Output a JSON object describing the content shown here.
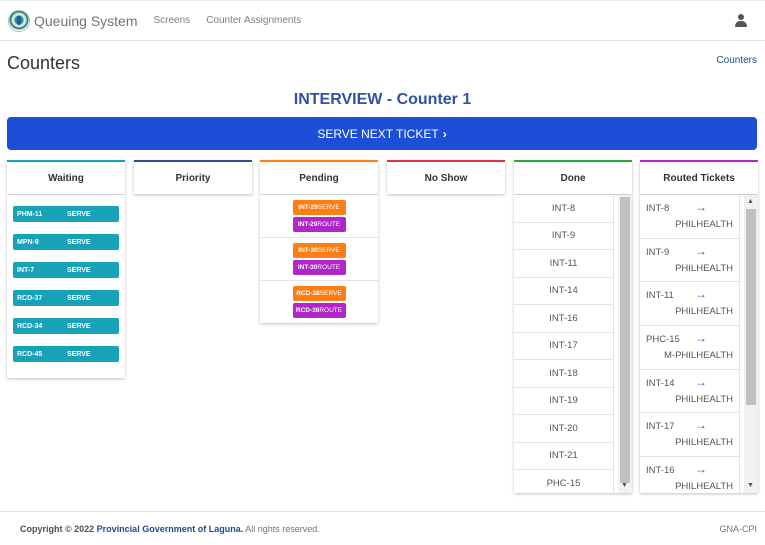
{
  "navbar": {
    "brand": "Queuing System",
    "links": [
      "Screens",
      "Counter Assignments"
    ]
  },
  "header": {
    "page_title": "Counters",
    "breadcrumb": "Counters",
    "counter_title": "INTERVIEW - Counter 1",
    "serve_next_label": "SERVE NEXT TICKET"
  },
  "columns": {
    "waiting": {
      "title": "Waiting",
      "color": "#17a2b8",
      "action_label": "SERVE",
      "items": [
        "PHM-11",
        "MPN-9",
        "INT-7",
        "RCD-37",
        "RCD-34",
        "RCD-45"
      ]
    },
    "priority": {
      "title": "Priority",
      "color": "#2f4f8f"
    },
    "pending": {
      "title": "Pending",
      "color": "#fd7e14",
      "serve_label": "SERVE",
      "route_label": "ROUTE",
      "items": [
        "INT-29",
        "INT-30",
        "RCD-38"
      ]
    },
    "no_show": {
      "title": "No Show",
      "color": "#dc3545"
    },
    "done": {
      "title": "Done",
      "color": "#28a745",
      "items": [
        "INT-8",
        "INT-9",
        "INT-11",
        "INT-14",
        "INT-16",
        "INT-17",
        "INT-18",
        "INT-19",
        "INT-20",
        "INT-21",
        "PHC-15"
      ]
    },
    "routed": {
      "title": "Routed Tickets",
      "color": "#b026c9",
      "items": [
        {
          "code": "INT-8",
          "dest": "PHILHEALTH"
        },
        {
          "code": "INT-9",
          "dest": "PHILHEALTH"
        },
        {
          "code": "INT-11",
          "dest": "PHILHEALTH"
        },
        {
          "code": "PHC-15",
          "dest": "M-PHILHEALTH"
        },
        {
          "code": "INT-14",
          "dest": "PHILHEALTH"
        },
        {
          "code": "INT-17",
          "dest": "PHILHEALTH"
        },
        {
          "code": "INT-16",
          "dest": "PHILHEALTH"
        }
      ]
    }
  },
  "footer": {
    "copyright_prefix": "Copyright © 2022",
    "org": "Provincial Government of Laguna.",
    "suffix": "All rights reserved.",
    "right": "GNA-CPI"
  }
}
